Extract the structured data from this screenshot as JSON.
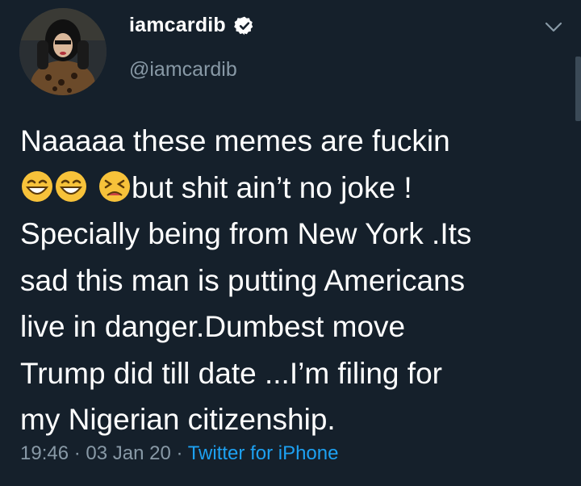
{
  "author": {
    "display_name": "iamcardib",
    "handle": "@iamcardib",
    "verified": true
  },
  "tweet": {
    "lines": [
      {
        "text": "Naaaaa these memes are fuckin"
      },
      {
        "text": "but shit ain’t no joke !"
      },
      {
        "text": "Specially being from New York .Its"
      },
      {
        "text": "sad this man is putting Americans"
      },
      {
        "text": "live in danger.Dumbest move"
      },
      {
        "text": "Trump did till date ...I’m filing for"
      },
      {
        "text": "my Nigerian citizenship."
      }
    ],
    "emojis": [
      "grinning-sweat-face-emoji",
      "grinning-sweat-face-emoji",
      "persevering-face-emoji"
    ]
  },
  "meta": {
    "time": "19:46",
    "sep1": " · ",
    "date": "03 Jan 20",
    "sep2": " · ",
    "source": "Twitter for iPhone"
  },
  "colors": {
    "background": "#15202b",
    "secondary_text": "#8899a6",
    "link": "#1da1f2",
    "verified_badge": "#ffffff"
  }
}
